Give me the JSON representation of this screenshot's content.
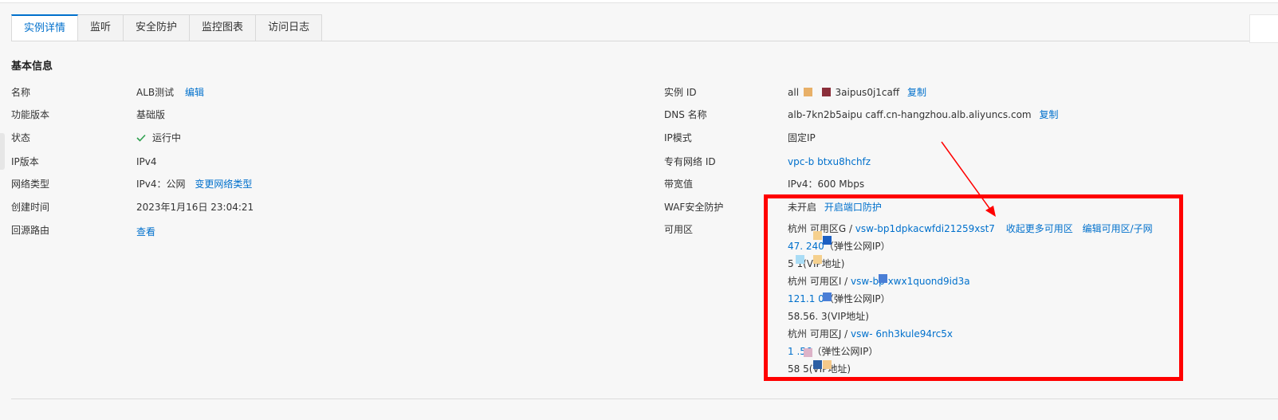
{
  "tabs": [
    {
      "label": "实例详情",
      "active": true
    },
    {
      "label": "监听",
      "active": false
    },
    {
      "label": "安全防护",
      "active": false
    },
    {
      "label": "监控图表",
      "active": false
    },
    {
      "label": "访问日志",
      "active": false
    }
  ],
  "section": {
    "title": "基本信息"
  },
  "left": {
    "name_label": "名称",
    "name_value": "ALB测试",
    "name_edit": "编辑",
    "edition_label": "功能版本",
    "edition_value": "基础版",
    "status_label": "状态",
    "status_value": "运行中",
    "ipver_label": "IP版本",
    "ipver_value": "IPv4",
    "nettype_label": "网络类型",
    "nettype_value": "IPv4：公网",
    "nettype_change": "变更网络类型",
    "created_label": "创建时间",
    "created_value": "2023年1月16日 23:04:21",
    "route_label": "回源路由",
    "route_view": "查看"
  },
  "right": {
    "id_label": "实例 ID",
    "id_prefix": "all",
    "id_suffix": "3aipus0j1caff",
    "id_copy": "复制",
    "dns_label": "DNS 名称",
    "dns_value": "alb-7kn2b5aipu caff.cn-hangzhou.alb.aliyuncs.com",
    "dns_copy": "复制",
    "ipmode_label": "IP模式",
    "ipmode_value": "固定IP",
    "vpc_label": "专有网络 ID",
    "vpc_value": "vpc-b btxu8hchfz",
    "bw_label": "带宽值",
    "bw_value": "IPv4：600 Mbps",
    "waf_label": "WAF安全防护",
    "waf_value": "未开启",
    "waf_open": "开启端口防护",
    "az_label": "可用区"
  },
  "zones": [
    {
      "name": "杭州 可用区G",
      "sep": " / ",
      "vsw": "vsw-bp1dpkacwfdi21259xst7",
      "collapse": "收起更多可用区",
      "edit": "编辑可用区/子网",
      "eip": "47. 240",
      "eip_note": "（弹性公网IP）",
      "vip": "5 1",
      "vip_note": "(VIP地址)"
    },
    {
      "name": "杭州 可用区I",
      "sep": " / ",
      "vsw": "vsw-bp xwx1quond9id3a",
      "eip": "121.1 0",
      "eip_note": "（弹性公网IP）",
      "vip": "58.56. 3",
      "vip_note": "(VIP地址)"
    },
    {
      "name": "杭州 可用区J",
      "sep": " / ",
      "vsw": "vsw- 6nh3kule94rc5x",
      "eip": "1 .56",
      "eip_note": "（弹性公网IP）",
      "vip": "58 5",
      "vip_note": "(VIP地址)"
    }
  ],
  "colors": {
    "accent": "#0070cc",
    "highlight": "#ff0000",
    "success": "#2fa04f"
  }
}
